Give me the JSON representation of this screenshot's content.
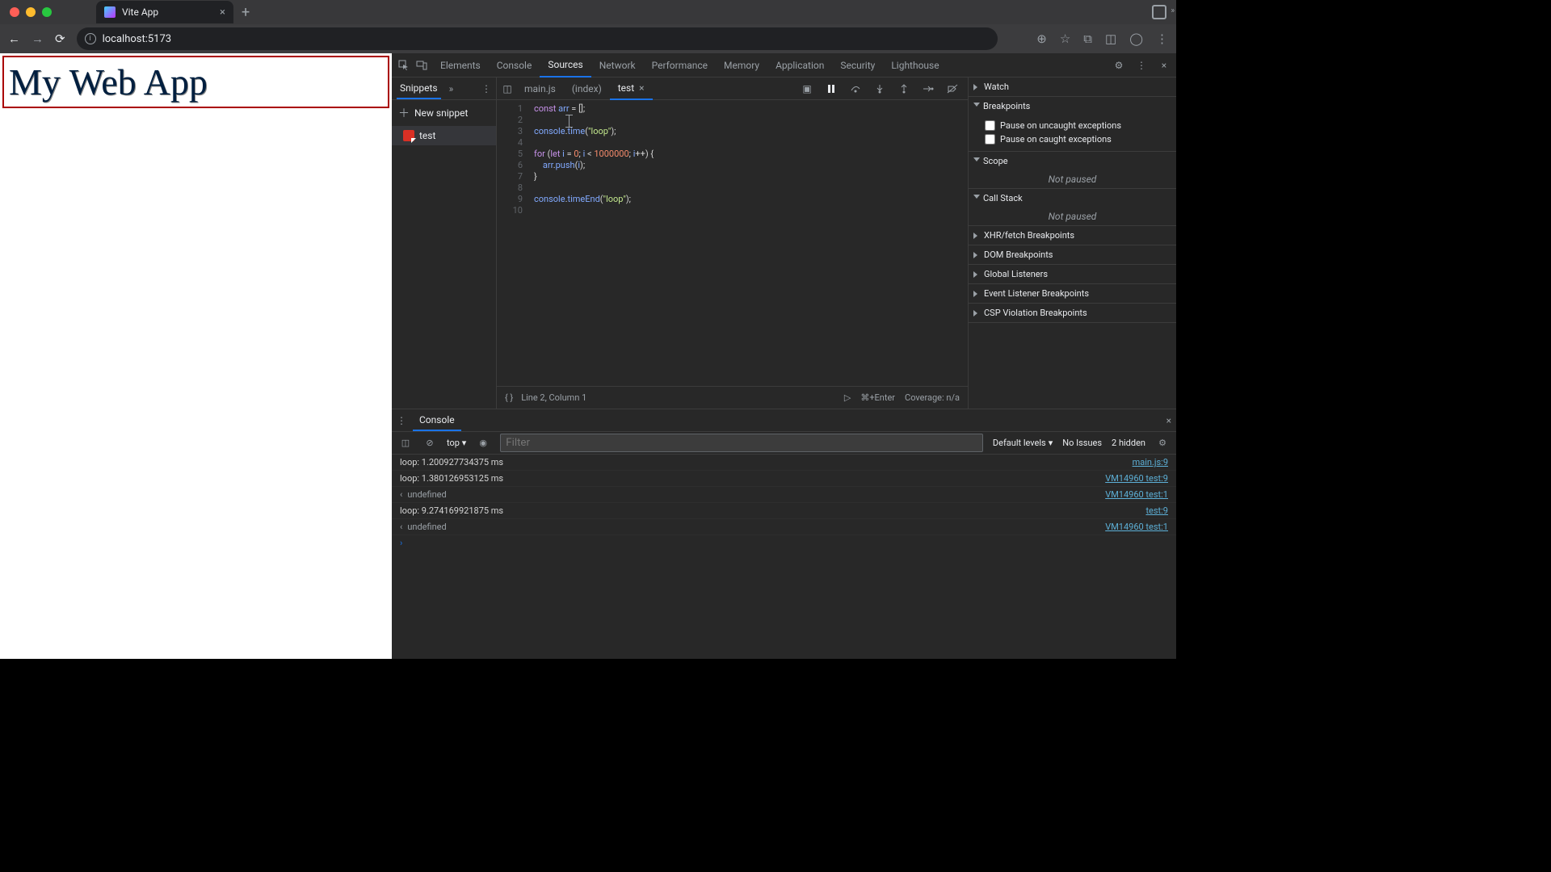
{
  "browser": {
    "tab_title": "Vite App",
    "url": "localhost:5173"
  },
  "page": {
    "heading": "My Web App"
  },
  "devtools": {
    "tabs": [
      "Elements",
      "Console",
      "Sources",
      "Network",
      "Performance",
      "Memory",
      "Application",
      "Security",
      "Lighthouse"
    ],
    "active_tab": "Sources"
  },
  "sources": {
    "nav_label": "Snippets",
    "new_snippet_label": "New snippet",
    "snippets": [
      "test"
    ],
    "editor_tabs": [
      {
        "label": "main.js",
        "active": false,
        "closable": false
      },
      {
        "label": "(index)",
        "active": false,
        "closable": false
      },
      {
        "label": "test",
        "active": true,
        "closable": true
      }
    ],
    "code_lines": [
      [
        {
          "t": "const ",
          "c": "kw"
        },
        {
          "t": "arr",
          "c": "var"
        },
        {
          "t": " = [];",
          "c": "pl"
        }
      ],
      [],
      [
        {
          "t": "console",
          "c": "var"
        },
        {
          "t": ".",
          "c": "pl"
        },
        {
          "t": "time",
          "c": "var"
        },
        {
          "t": "(",
          "c": "pl"
        },
        {
          "t": "\"loop\"",
          "c": "str"
        },
        {
          "t": ");",
          "c": "pl"
        }
      ],
      [],
      [
        {
          "t": "for ",
          "c": "kw"
        },
        {
          "t": "(",
          "c": "pl"
        },
        {
          "t": "let ",
          "c": "kw"
        },
        {
          "t": "i",
          "c": "var"
        },
        {
          "t": " = ",
          "c": "pl"
        },
        {
          "t": "0",
          "c": "num"
        },
        {
          "t": "; ",
          "c": "pl"
        },
        {
          "t": "i",
          "c": "var"
        },
        {
          "t": " < ",
          "c": "pl"
        },
        {
          "t": "1000000",
          "c": "num"
        },
        {
          "t": "; ",
          "c": "pl"
        },
        {
          "t": "i",
          "c": "var"
        },
        {
          "t": "++) {",
          "c": "pl"
        }
      ],
      [
        {
          "t": "    arr",
          "c": "var"
        },
        {
          "t": ".",
          "c": "pl"
        },
        {
          "t": "push",
          "c": "var"
        },
        {
          "t": "(",
          "c": "pl"
        },
        {
          "t": "i",
          "c": "var"
        },
        {
          "t": ");",
          "c": "pl"
        }
      ],
      [
        {
          "t": "}",
          "c": "pl"
        }
      ],
      [],
      [
        {
          "t": "console",
          "c": "var"
        },
        {
          "t": ".",
          "c": "pl"
        },
        {
          "t": "timeEnd",
          "c": "var"
        },
        {
          "t": "(",
          "c": "pl"
        },
        {
          "t": "\"loop\"",
          "c": "str"
        },
        {
          "t": ");",
          "c": "pl"
        }
      ],
      []
    ],
    "status_cursor": "Line 2, Column 1",
    "status_run": "⌘+Enter",
    "status_coverage": "Coverage: n/a"
  },
  "debugger_toolbar": {
    "items": [
      "pause",
      "step-over",
      "step-into",
      "step-out",
      "step",
      "deactivate-breakpoints"
    ]
  },
  "debugger": {
    "watch": "Watch",
    "breakpoints": "Breakpoints",
    "bp_uncaught": "Pause on uncaught exceptions",
    "bp_caught": "Pause on caught exceptions",
    "scope": "Scope",
    "callstack": "Call Stack",
    "not_paused": "Not paused",
    "xhr": "XHR/fetch Breakpoints",
    "dom": "DOM Breakpoints",
    "global": "Global Listeners",
    "event": "Event Listener Breakpoints",
    "csp": "CSP Violation Breakpoints"
  },
  "console": {
    "tab": "Console",
    "context": "top",
    "filter_placeholder": "Filter",
    "levels": "Default levels",
    "issues": "No Issues",
    "hidden": "2 hidden",
    "rows": [
      {
        "msg": "loop: 1.200927734375 ms",
        "src": "main.js:9",
        "ret": false
      },
      {
        "msg": "loop: 1.380126953125 ms",
        "src": "VM14960 test:9",
        "ret": false
      },
      {
        "msg": "undefined",
        "src": "VM14960 test:1",
        "ret": true
      },
      {
        "msg": "loop: 9.274169921875 ms",
        "src": "test:9",
        "ret": false
      },
      {
        "msg": "undefined",
        "src": "VM14960 test:1",
        "ret": true
      }
    ]
  }
}
